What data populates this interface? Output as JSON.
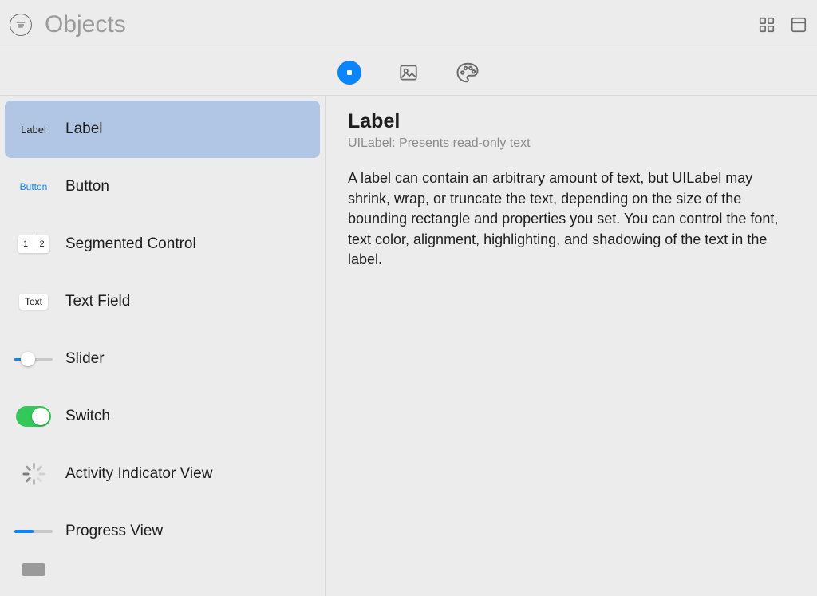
{
  "search": {
    "placeholder": "Objects"
  },
  "items": [
    {
      "icon_text": "Label",
      "label": "Label",
      "selected": true
    },
    {
      "icon_text": "Button",
      "label": "Button"
    },
    {
      "icon_text": "1|2",
      "label": "Segmented Control"
    },
    {
      "icon_text": "Text",
      "label": "Text Field"
    },
    {
      "label": "Slider"
    },
    {
      "label": "Switch"
    },
    {
      "label": "Activity Indicator View"
    },
    {
      "label": "Progress View"
    }
  ],
  "segmented": {
    "seg1": "1",
    "seg2": "2"
  },
  "detail": {
    "title": "Label",
    "subtitle": "UILabel: Presents read-only text",
    "body": "A label can contain an arbitrary amount of text, but UILabel may shrink, wrap, or truncate the text, depending on the size of the bounding rectangle and properties you set. You can control the font, text color, alignment, highlighting, and shadowing of the text in the label."
  }
}
